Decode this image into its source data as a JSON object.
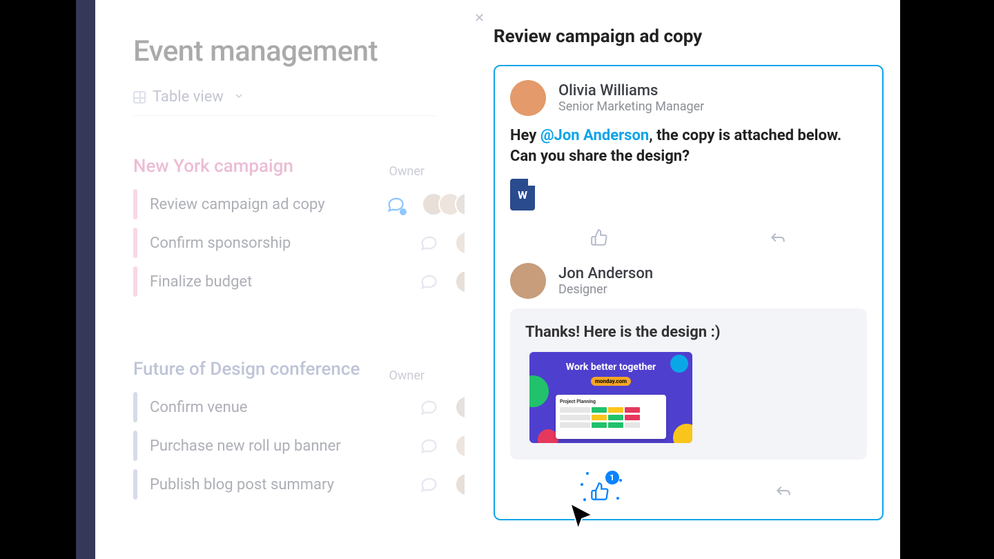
{
  "page": {
    "title": "Event management",
    "view_switch": "Table view"
  },
  "columns": {
    "owner": "Owner"
  },
  "groups": [
    {
      "name": "New York campaign",
      "tasks": [
        {
          "name": "Review campaign ad copy",
          "active_chat": true,
          "owners": 3
        },
        {
          "name": "Confirm sponsorship",
          "active_chat": false,
          "owners": 1
        },
        {
          "name": "Finalize budget",
          "active_chat": false,
          "owners": 1
        }
      ]
    },
    {
      "name": "Future of Design conference",
      "tasks": [
        {
          "name": "Confirm venue",
          "active_chat": false,
          "owners": 1
        },
        {
          "name": "Purchase new roll up banner",
          "active_chat": false,
          "owners": 1
        },
        {
          "name": "Publish blog post summary",
          "active_chat": false,
          "owners": 1
        }
      ]
    }
  ],
  "detail": {
    "title": "Review campaign ad copy",
    "post": {
      "author_name": "Olivia  Williams",
      "author_role": "Senior Marketing Manager",
      "text_prefix": "Hey ",
      "mention": "@Jon Anderson",
      "text_suffix": ", the copy is attached below. Can you share the design?",
      "attachment_letter": "W"
    },
    "reply": {
      "author_name": "Jon Anderson",
      "author_role": "Designer",
      "text": "Thanks! Here is the design :)",
      "thumb_headline": "Work better together",
      "thumb_pill": "monday.com",
      "thumb_card_title": "Project Planning",
      "like_count": "1"
    }
  }
}
